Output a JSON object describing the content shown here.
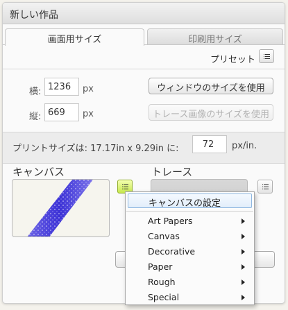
{
  "window": {
    "title": "新しい作品"
  },
  "tabs": [
    {
      "label": "画面用サイズ",
      "active": true
    },
    {
      "label": "印刷用サイズ",
      "active": false
    }
  ],
  "preset": {
    "label": "プリセット"
  },
  "size": {
    "width_label": "横:",
    "width_value": "1236",
    "height_label": "縦:",
    "height_value": "669",
    "unit": "px",
    "use_window_label": "ウィンドウのサイズを使用",
    "use_trace_label": "トレース画像のサイズを使用"
  },
  "print": {
    "prefix": "プリントサイズは: 17.17in x 9.29in に:",
    "dpi_value": "72",
    "suffix": "px/in."
  },
  "canvas": {
    "heading": "キャンバス"
  },
  "trace": {
    "heading": "トレース"
  },
  "canvas_menu": {
    "header": "キャンバスの設定",
    "items": [
      "Art Papers",
      "Canvas",
      "Decorative",
      "Paper",
      "Rough",
      "Special"
    ]
  },
  "colors": {
    "accent_green": "#c6e84c",
    "menu_highlight_border": "#8fb7e0",
    "stroke_blue": "#4a3fd8"
  }
}
